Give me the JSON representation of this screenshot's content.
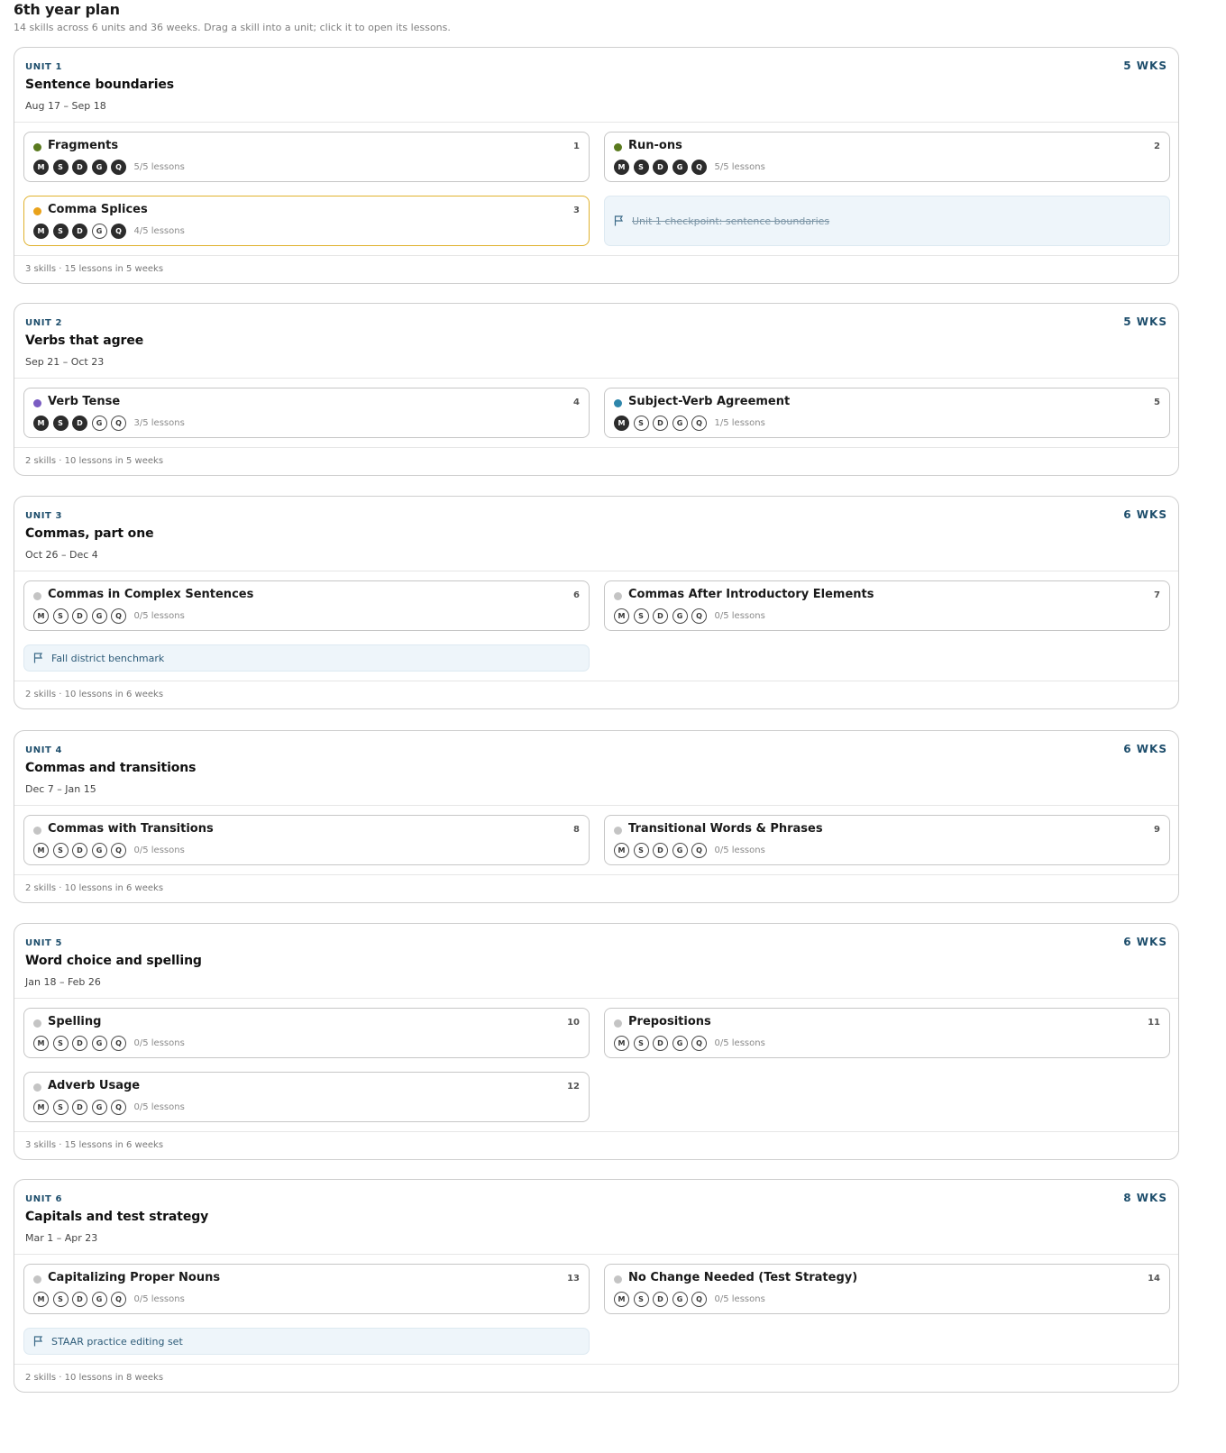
{
  "page": {
    "title": "6th year plan",
    "subtitle": "14 skills across 6 units and 36 weeks. Drag a skill into a unit; click it to open its lessons."
  },
  "colors": {
    "accent": "#1e4e6c",
    "active_border": "#e0b22e",
    "checkpoint_bg": "#eef5fa"
  },
  "badge_letters": [
    "M",
    "S",
    "D",
    "G",
    "Q"
  ],
  "units": [
    {
      "label": "UNIT 1",
      "title": "Sentence boundaries",
      "dates": "Aug 17 – Sep 18",
      "weeks": "5 WKS",
      "footer": "3 skills · 15 lessons in 5 weeks",
      "items": [
        {
          "kind": "skill",
          "name": "Fragments",
          "num": "1",
          "dot": "#5a7a1e",
          "done": [
            1,
            1,
            1,
            1,
            1
          ],
          "lessons": "5/5 lessons"
        },
        {
          "kind": "skill",
          "name": "Run-ons",
          "num": "2",
          "dot": "#5a7a1e",
          "done": [
            1,
            1,
            1,
            1,
            1
          ],
          "lessons": "5/5 lessons"
        },
        {
          "kind": "skill",
          "name": "Comma Splices",
          "num": "3",
          "dot": "#e9a21a",
          "done": [
            1,
            1,
            1,
            0,
            1
          ],
          "lessons": "4/5 lessons",
          "active": true
        },
        {
          "kind": "checkpoint",
          "text": "Unit 1 checkpoint: sentence boundaries",
          "struck": true
        }
      ]
    },
    {
      "label": "UNIT 2",
      "title": "Verbs that agree",
      "dates": "Sep 21 – Oct 23",
      "weeks": "5 WKS",
      "footer": "2 skills · 10 lessons in 5 weeks",
      "items": [
        {
          "kind": "skill",
          "name": "Verb Tense",
          "num": "4",
          "dot": "#7a5cc2",
          "done": [
            1,
            1,
            1,
            0,
            0
          ],
          "lessons": "3/5 lessons"
        },
        {
          "kind": "skill",
          "name": "Subject-Verb Agreement",
          "num": "5",
          "dot": "#2e86ab",
          "done": [
            1,
            0,
            0,
            0,
            0
          ],
          "lessons": "1/5 lessons"
        }
      ]
    },
    {
      "label": "UNIT 3",
      "title": "Commas, part one",
      "dates": "Oct 26 – Dec 4",
      "weeks": "6 WKS",
      "footer": "2 skills · 10 lessons in 6 weeks",
      "items": [
        {
          "kind": "skill",
          "name": "Commas in Complex Sentences",
          "num": "6",
          "dot": "#c4c4c4",
          "done": [
            0,
            0,
            0,
            0,
            0
          ],
          "lessons": "0/5 lessons"
        },
        {
          "kind": "skill",
          "name": "Commas After Introductory Elements",
          "num": "7",
          "dot": "#c4c4c4",
          "done": [
            0,
            0,
            0,
            0,
            0
          ],
          "lessons": "0/5 lessons"
        },
        {
          "kind": "checkpoint",
          "text": "Fall district benchmark",
          "struck": false
        }
      ]
    },
    {
      "label": "UNIT 4",
      "title": "Commas and transitions",
      "dates": "Dec 7 – Jan 15",
      "weeks": "6 WKS",
      "footer": "2 skills · 10 lessons in 6 weeks",
      "items": [
        {
          "kind": "skill",
          "name": "Commas with Transitions",
          "num": "8",
          "dot": "#c4c4c4",
          "done": [
            0,
            0,
            0,
            0,
            0
          ],
          "lessons": "0/5 lessons"
        },
        {
          "kind": "skill",
          "name": "Transitional Words & Phrases",
          "num": "9",
          "dot": "#c4c4c4",
          "done": [
            0,
            0,
            0,
            0,
            0
          ],
          "lessons": "0/5 lessons"
        }
      ]
    },
    {
      "label": "UNIT 5",
      "title": "Word choice and spelling",
      "dates": "Jan 18 – Feb 26",
      "weeks": "6 WKS",
      "footer": "3 skills · 15 lessons in 6 weeks",
      "items": [
        {
          "kind": "skill",
          "name": "Spelling",
          "num": "10",
          "dot": "#c4c4c4",
          "done": [
            0,
            0,
            0,
            0,
            0
          ],
          "lessons": "0/5 lessons"
        },
        {
          "kind": "skill",
          "name": "Prepositions",
          "num": "11",
          "dot": "#c4c4c4",
          "done": [
            0,
            0,
            0,
            0,
            0
          ],
          "lessons": "0/5 lessons"
        },
        {
          "kind": "skill",
          "name": "Adverb Usage",
          "num": "12",
          "dot": "#c4c4c4",
          "done": [
            0,
            0,
            0,
            0,
            0
          ],
          "lessons": "0/5 lessons"
        }
      ]
    },
    {
      "label": "UNIT 6",
      "title": "Capitals and test strategy",
      "dates": "Mar 1 – Apr 23",
      "weeks": "8 WKS",
      "footer": "2 skills · 10 lessons in 8 weeks",
      "items": [
        {
          "kind": "skill",
          "name": "Capitalizing Proper Nouns",
          "num": "13",
          "dot": "#c4c4c4",
          "done": [
            0,
            0,
            0,
            0,
            0
          ],
          "lessons": "0/5 lessons"
        },
        {
          "kind": "skill",
          "name": "No Change Needed (Test Strategy)",
          "num": "14",
          "dot": "#c4c4c4",
          "done": [
            0,
            0,
            0,
            0,
            0
          ],
          "lessons": "0/5 lessons"
        },
        {
          "kind": "checkpoint",
          "text": "STAAR practice editing set",
          "struck": false
        }
      ]
    }
  ]
}
